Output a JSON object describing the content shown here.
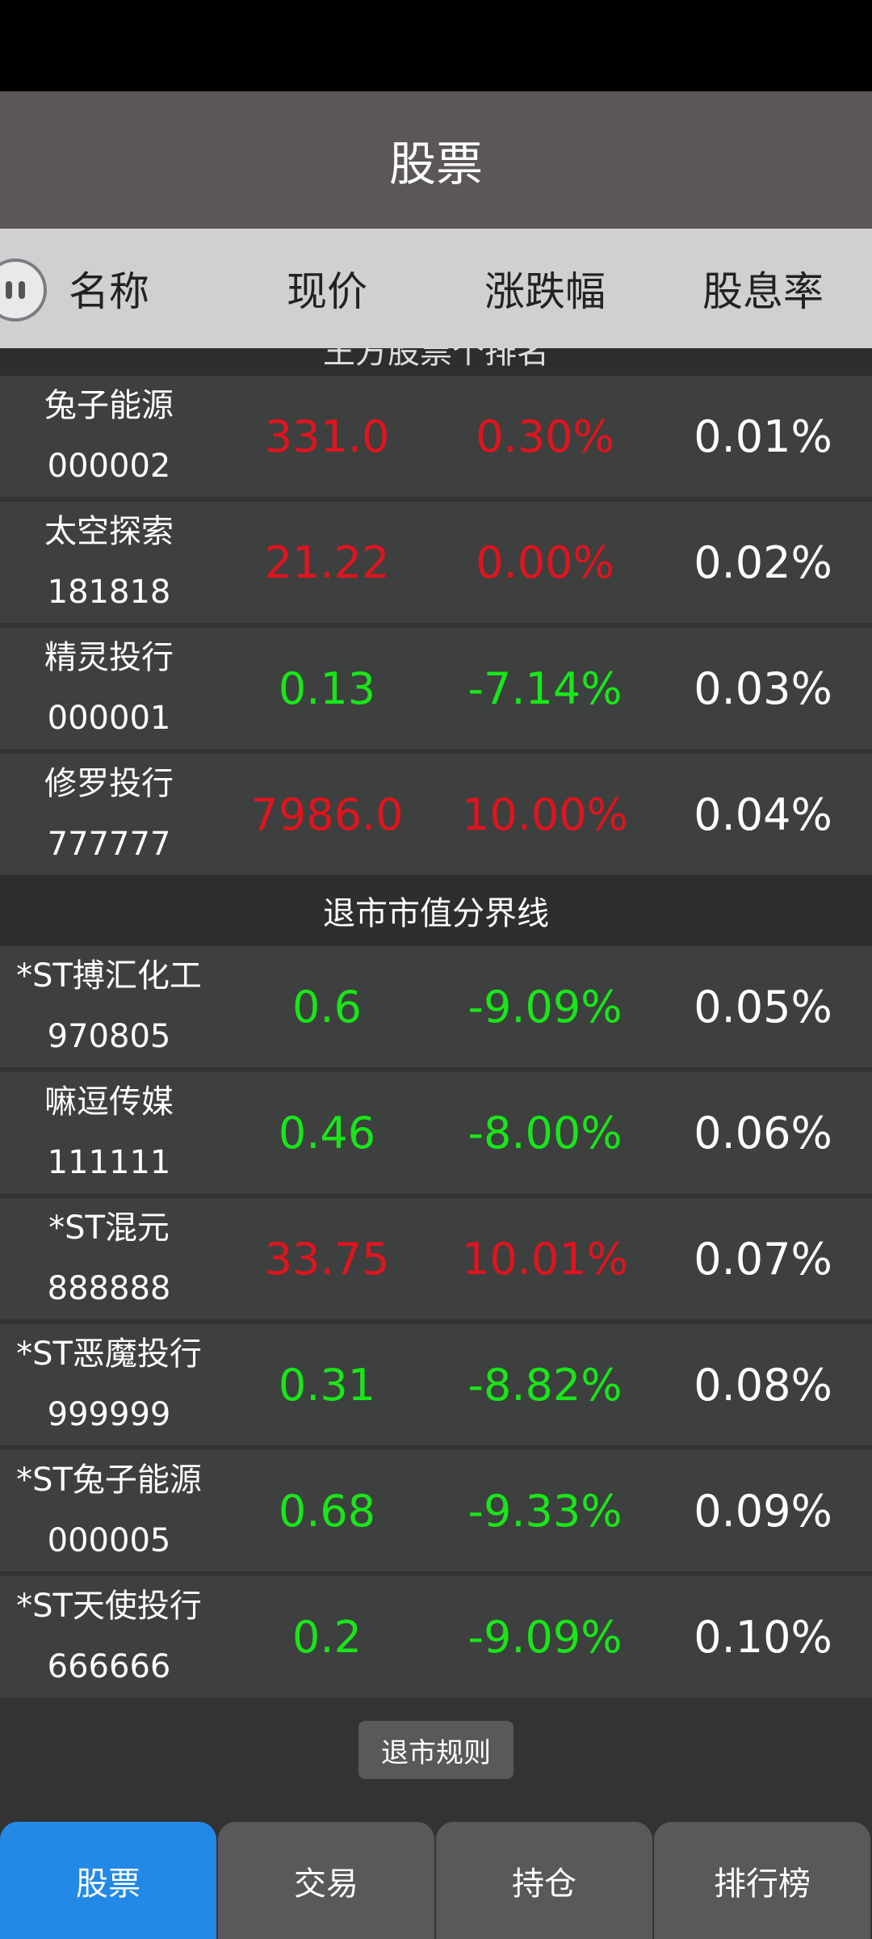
{
  "title": "股票",
  "columns": [
    "名称",
    "现价",
    "涨跌幅",
    "股息率"
  ],
  "subheader": "王方股票个排名",
  "stocks_above": [
    {
      "name": "兔子能源",
      "code": "000002",
      "price": "331.0",
      "change": "0.30%",
      "yield": "0.01%",
      "dir": "up"
    },
    {
      "name": "太空探索",
      "code": "181818",
      "price": "21.22",
      "change": "0.00%",
      "yield": "0.02%",
      "dir": "up"
    },
    {
      "name": "精灵投行",
      "code": "000001",
      "price": "0.13",
      "change": "-7.14%",
      "yield": "0.03%",
      "dir": "down"
    },
    {
      "name": "修罗投行",
      "code": "777777",
      "price": "7986.0",
      "change": "10.00%",
      "yield": "0.04%",
      "dir": "up"
    }
  ],
  "divider_label": "退市市值分界线",
  "stocks_below": [
    {
      "name": "*ST搏汇化工",
      "code": "970805",
      "price": "0.6",
      "change": "-9.09%",
      "yield": "0.05%",
      "dir": "down"
    },
    {
      "name": "嘛逗传媒",
      "code": "111111",
      "price": "0.46",
      "change": "-8.00%",
      "yield": "0.06%",
      "dir": "down"
    },
    {
      "name": "*ST混元",
      "code": "888888",
      "price": "33.75",
      "change": "10.01%",
      "yield": "0.07%",
      "dir": "up"
    },
    {
      "name": "*ST恶魔投行",
      "code": "999999",
      "price": "0.31",
      "change": "-8.82%",
      "yield": "0.08%",
      "dir": "down"
    },
    {
      "name": "*ST兔子能源",
      "code": "000005",
      "price": "0.68",
      "change": "-9.33%",
      "yield": "0.09%",
      "dir": "down"
    },
    {
      "name": "*ST天使投行",
      "code": "666666",
      "price": "0.2",
      "change": "-9.09%",
      "yield": "0.10%",
      "dir": "down"
    }
  ],
  "rules_button": "退市规则",
  "nav": [
    "股票",
    "交易",
    "持仓",
    "排行榜"
  ],
  "active_nav": 0,
  "colors": {
    "up": "#e0141e",
    "down": "#19e619",
    "active_nav": "#2289e6"
  }
}
